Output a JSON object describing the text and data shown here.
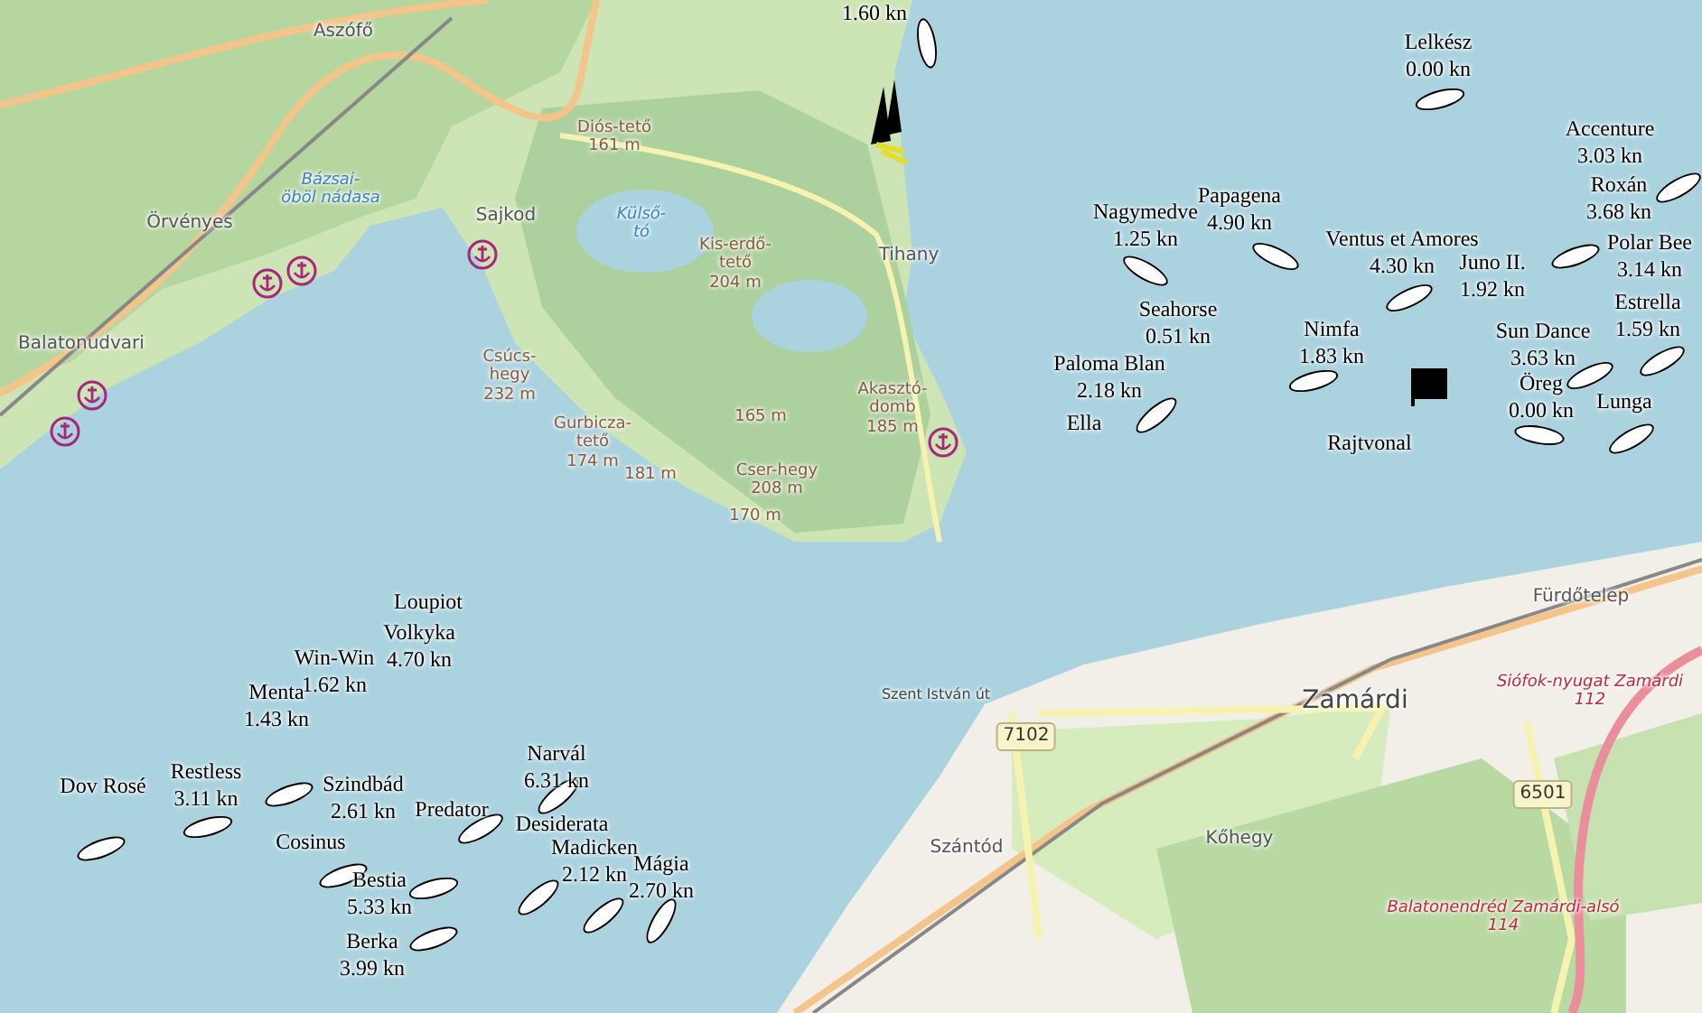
{
  "map": {
    "places": [
      {
        "text": "Aszófő",
        "kind": "town"
      },
      {
        "text": "Diós-tető\n161 m",
        "kind": "peak"
      },
      {
        "text": "Bázsai-\nöböl nádasa",
        "kind": "water"
      },
      {
        "text": "Örvényes",
        "kind": "town"
      },
      {
        "text": "Sajkod",
        "kind": "town"
      },
      {
        "text": "Külső-\ntó",
        "kind": "water"
      },
      {
        "text": "Kis-erdő-\ntető\n204 m",
        "kind": "peak"
      },
      {
        "text": "Tihany",
        "kind": "town"
      },
      {
        "text": "Balatonudvari",
        "kind": "town"
      },
      {
        "text": "Csúcs-\nhegy\n232 m",
        "kind": "peak"
      },
      {
        "text": "Akasztó-\ndomb\n185 m",
        "kind": "peak"
      },
      {
        "text": "165 m",
        "kind": "peak"
      },
      {
        "text": "Gurbicza-\ntető\n174 m",
        "kind": "peak"
      },
      {
        "text": "181 m",
        "kind": "peak"
      },
      {
        "text": "Cser-hegy\n208 m",
        "kind": "peak"
      },
      {
        "text": "170 m",
        "kind": "peak"
      },
      {
        "text": "Fürdőtelep",
        "kind": "town"
      },
      {
        "text": "Szent István út",
        "kind": "road"
      },
      {
        "text": "Zamárdi",
        "kind": "city"
      },
      {
        "text": "Siófok-nyugat Zamárdi\n112",
        "kind": "junction"
      },
      {
        "text": "7102",
        "kind": "shield"
      },
      {
        "text": "6501",
        "kind": "shield"
      },
      {
        "text": "Szántód",
        "kind": "town"
      },
      {
        "text": "Kőhegy",
        "kind": "town"
      },
      {
        "text": "Balatonendréd Zamárdi-alsó\n114",
        "kind": "junction"
      }
    ]
  },
  "vessels": [
    {
      "speed": "1.60 kn"
    },
    {
      "name": "Lelkész",
      "speed": "0.00 kn"
    },
    {
      "name": "Accenture",
      "speed": "3.03 kn"
    },
    {
      "name": "Roxán",
      "speed": "3.68 kn"
    },
    {
      "name": "Nagymedve",
      "speed": "1.25 kn"
    },
    {
      "name": "Papagena",
      "speed": "4.90 kn"
    },
    {
      "name": "Ventus et Amores",
      "speed": "4.30 kn"
    },
    {
      "name": "Polar Bee",
      "speed": "3.14 kn"
    },
    {
      "name": "Juno II.",
      "speed": "1.92 kn"
    },
    {
      "name": "Seahorse",
      "speed": "0.51 kn"
    },
    {
      "name": "Estrella",
      "speed": "1.59 kn"
    },
    {
      "name": "Nimfa",
      "speed": "1.83 kn"
    },
    {
      "name": "Sun Dance",
      "speed": "3.63 kn"
    },
    {
      "name": "Paloma Blan",
      "speed": "2.18 kn"
    },
    {
      "name": "Öreg",
      "speed": "0.00 kn"
    },
    {
      "name": "Lunga"
    },
    {
      "name": "Ella"
    },
    {
      "name": "Rajtvonal"
    },
    {
      "name": "Loupiot"
    },
    {
      "name": "Win-Win",
      "speed": "1.62 kn"
    },
    {
      "name": "Volkyka",
      "speed": "4.70 kn"
    },
    {
      "name": "Menta",
      "speed": "1.43 kn"
    },
    {
      "name": "Dov Rosé"
    },
    {
      "name": "Restless",
      "speed": "3.11 kn"
    },
    {
      "name": "Szindbád",
      "speed": "2.61 kn"
    },
    {
      "name": "Predator"
    },
    {
      "name": "Narvál",
      "speed": "6.31 kn"
    },
    {
      "name": "Desiderata"
    },
    {
      "name": "Cosinus"
    },
    {
      "name": "Madicken",
      "speed": "2.12 kn"
    },
    {
      "name": "Mágia",
      "speed": "2.70 kn"
    },
    {
      "name": "Bestia",
      "speed": "5.33 kn"
    },
    {
      "name": "Berka",
      "speed": "3.99 kn"
    }
  ]
}
